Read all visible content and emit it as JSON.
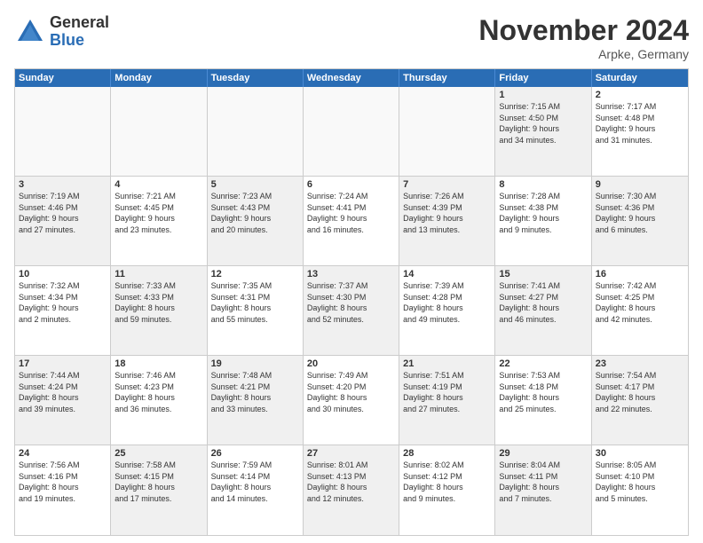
{
  "logo": {
    "general": "General",
    "blue": "Blue"
  },
  "header": {
    "month": "November 2024",
    "location": "Arpke, Germany"
  },
  "weekdays": [
    "Sunday",
    "Monday",
    "Tuesday",
    "Wednesday",
    "Thursday",
    "Friday",
    "Saturday"
  ],
  "weeks": [
    [
      {
        "day": "",
        "info": "",
        "empty": true
      },
      {
        "day": "",
        "info": "",
        "empty": true
      },
      {
        "day": "",
        "info": "",
        "empty": true
      },
      {
        "day": "",
        "info": "",
        "empty": true
      },
      {
        "day": "",
        "info": "",
        "empty": true
      },
      {
        "day": "1",
        "info": "Sunrise: 7:15 AM\nSunset: 4:50 PM\nDaylight: 9 hours\nand 34 minutes.",
        "shaded": true
      },
      {
        "day": "2",
        "info": "Sunrise: 7:17 AM\nSunset: 4:48 PM\nDaylight: 9 hours\nand 31 minutes.",
        "shaded": false
      }
    ],
    [
      {
        "day": "3",
        "info": "Sunrise: 7:19 AM\nSunset: 4:46 PM\nDaylight: 9 hours\nand 27 minutes.",
        "shaded": true
      },
      {
        "day": "4",
        "info": "Sunrise: 7:21 AM\nSunset: 4:45 PM\nDaylight: 9 hours\nand 23 minutes.",
        "shaded": false
      },
      {
        "day": "5",
        "info": "Sunrise: 7:23 AM\nSunset: 4:43 PM\nDaylight: 9 hours\nand 20 minutes.",
        "shaded": true
      },
      {
        "day": "6",
        "info": "Sunrise: 7:24 AM\nSunset: 4:41 PM\nDaylight: 9 hours\nand 16 minutes.",
        "shaded": false
      },
      {
        "day": "7",
        "info": "Sunrise: 7:26 AM\nSunset: 4:39 PM\nDaylight: 9 hours\nand 13 minutes.",
        "shaded": true
      },
      {
        "day": "8",
        "info": "Sunrise: 7:28 AM\nSunset: 4:38 PM\nDaylight: 9 hours\nand 9 minutes.",
        "shaded": false
      },
      {
        "day": "9",
        "info": "Sunrise: 7:30 AM\nSunset: 4:36 PM\nDaylight: 9 hours\nand 6 minutes.",
        "shaded": true
      }
    ],
    [
      {
        "day": "10",
        "info": "Sunrise: 7:32 AM\nSunset: 4:34 PM\nDaylight: 9 hours\nand 2 minutes.",
        "shaded": false
      },
      {
        "day": "11",
        "info": "Sunrise: 7:33 AM\nSunset: 4:33 PM\nDaylight: 8 hours\nand 59 minutes.",
        "shaded": true
      },
      {
        "day": "12",
        "info": "Sunrise: 7:35 AM\nSunset: 4:31 PM\nDaylight: 8 hours\nand 55 minutes.",
        "shaded": false
      },
      {
        "day": "13",
        "info": "Sunrise: 7:37 AM\nSunset: 4:30 PM\nDaylight: 8 hours\nand 52 minutes.",
        "shaded": true
      },
      {
        "day": "14",
        "info": "Sunrise: 7:39 AM\nSunset: 4:28 PM\nDaylight: 8 hours\nand 49 minutes.",
        "shaded": false
      },
      {
        "day": "15",
        "info": "Sunrise: 7:41 AM\nSunset: 4:27 PM\nDaylight: 8 hours\nand 46 minutes.",
        "shaded": true
      },
      {
        "day": "16",
        "info": "Sunrise: 7:42 AM\nSunset: 4:25 PM\nDaylight: 8 hours\nand 42 minutes.",
        "shaded": false
      }
    ],
    [
      {
        "day": "17",
        "info": "Sunrise: 7:44 AM\nSunset: 4:24 PM\nDaylight: 8 hours\nand 39 minutes.",
        "shaded": true
      },
      {
        "day": "18",
        "info": "Sunrise: 7:46 AM\nSunset: 4:23 PM\nDaylight: 8 hours\nand 36 minutes.",
        "shaded": false
      },
      {
        "day": "19",
        "info": "Sunrise: 7:48 AM\nSunset: 4:21 PM\nDaylight: 8 hours\nand 33 minutes.",
        "shaded": true
      },
      {
        "day": "20",
        "info": "Sunrise: 7:49 AM\nSunset: 4:20 PM\nDaylight: 8 hours\nand 30 minutes.",
        "shaded": false
      },
      {
        "day": "21",
        "info": "Sunrise: 7:51 AM\nSunset: 4:19 PM\nDaylight: 8 hours\nand 27 minutes.",
        "shaded": true
      },
      {
        "day": "22",
        "info": "Sunrise: 7:53 AM\nSunset: 4:18 PM\nDaylight: 8 hours\nand 25 minutes.",
        "shaded": false
      },
      {
        "day": "23",
        "info": "Sunrise: 7:54 AM\nSunset: 4:17 PM\nDaylight: 8 hours\nand 22 minutes.",
        "shaded": true
      }
    ],
    [
      {
        "day": "24",
        "info": "Sunrise: 7:56 AM\nSunset: 4:16 PM\nDaylight: 8 hours\nand 19 minutes.",
        "shaded": false
      },
      {
        "day": "25",
        "info": "Sunrise: 7:58 AM\nSunset: 4:15 PM\nDaylight: 8 hours\nand 17 minutes.",
        "shaded": true
      },
      {
        "day": "26",
        "info": "Sunrise: 7:59 AM\nSunset: 4:14 PM\nDaylight: 8 hours\nand 14 minutes.",
        "shaded": false
      },
      {
        "day": "27",
        "info": "Sunrise: 8:01 AM\nSunset: 4:13 PM\nDaylight: 8 hours\nand 12 minutes.",
        "shaded": true
      },
      {
        "day": "28",
        "info": "Sunrise: 8:02 AM\nSunset: 4:12 PM\nDaylight: 8 hours\nand 9 minutes.",
        "shaded": false
      },
      {
        "day": "29",
        "info": "Sunrise: 8:04 AM\nSunset: 4:11 PM\nDaylight: 8 hours\nand 7 minutes.",
        "shaded": true
      },
      {
        "day": "30",
        "info": "Sunrise: 8:05 AM\nSunset: 4:10 PM\nDaylight: 8 hours\nand 5 minutes.",
        "shaded": false
      }
    ]
  ]
}
